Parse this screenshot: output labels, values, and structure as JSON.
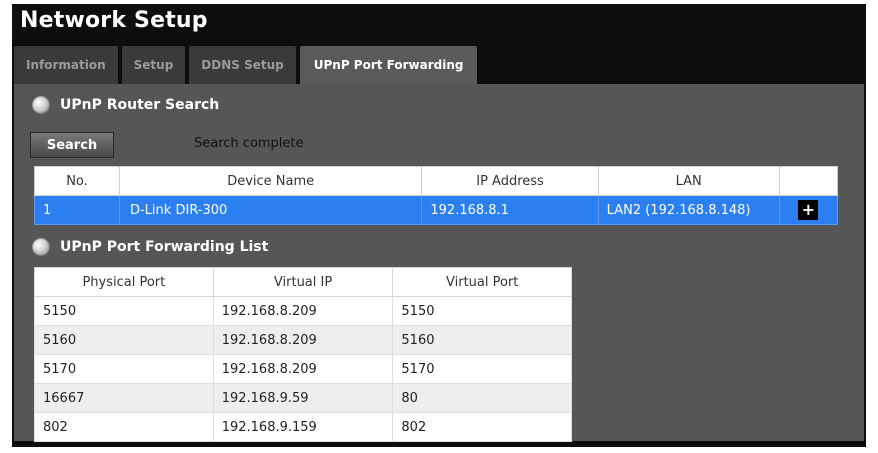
{
  "window": {
    "title": "Network Setup"
  },
  "tabs": [
    {
      "label": "Information"
    },
    {
      "label": "Setup"
    },
    {
      "label": "DDNS Setup"
    },
    {
      "label": "UPnP Port Forwarding",
      "active": true
    }
  ],
  "router_search": {
    "heading": "UPnP Router Search",
    "search_button": "Search",
    "status": "Search complete",
    "columns": [
      "No.",
      "Device Name",
      "IP Address",
      "LAN",
      ""
    ],
    "rows": [
      {
        "no": "1",
        "device": "D-Link DIR-300",
        "ip": "192.168.8.1",
        "lan": "LAN2 (192.168.8.148)",
        "action_icon": "plus-icon"
      }
    ]
  },
  "port_forwarding": {
    "heading": "UPnP Port Forwarding List",
    "columns": [
      "Physical Port",
      "Virtual IP",
      "Virtual Port"
    ],
    "rows": [
      {
        "physical": "5150",
        "ip": "192.168.8.209",
        "virtual": "5150"
      },
      {
        "physical": "5160",
        "ip": "192.168.8.209",
        "virtual": "5160"
      },
      {
        "physical": "5170",
        "ip": "192.168.8.209",
        "virtual": "5170"
      },
      {
        "physical": "16667",
        "ip": "192.168.9.59",
        "virtual": "80"
      },
      {
        "physical": "802",
        "ip": "192.168.9.159",
        "virtual": "802"
      }
    ]
  },
  "colors": {
    "selected_row": "#2b7ff1",
    "panel": "#565656",
    "window": "#0d0d0d"
  }
}
